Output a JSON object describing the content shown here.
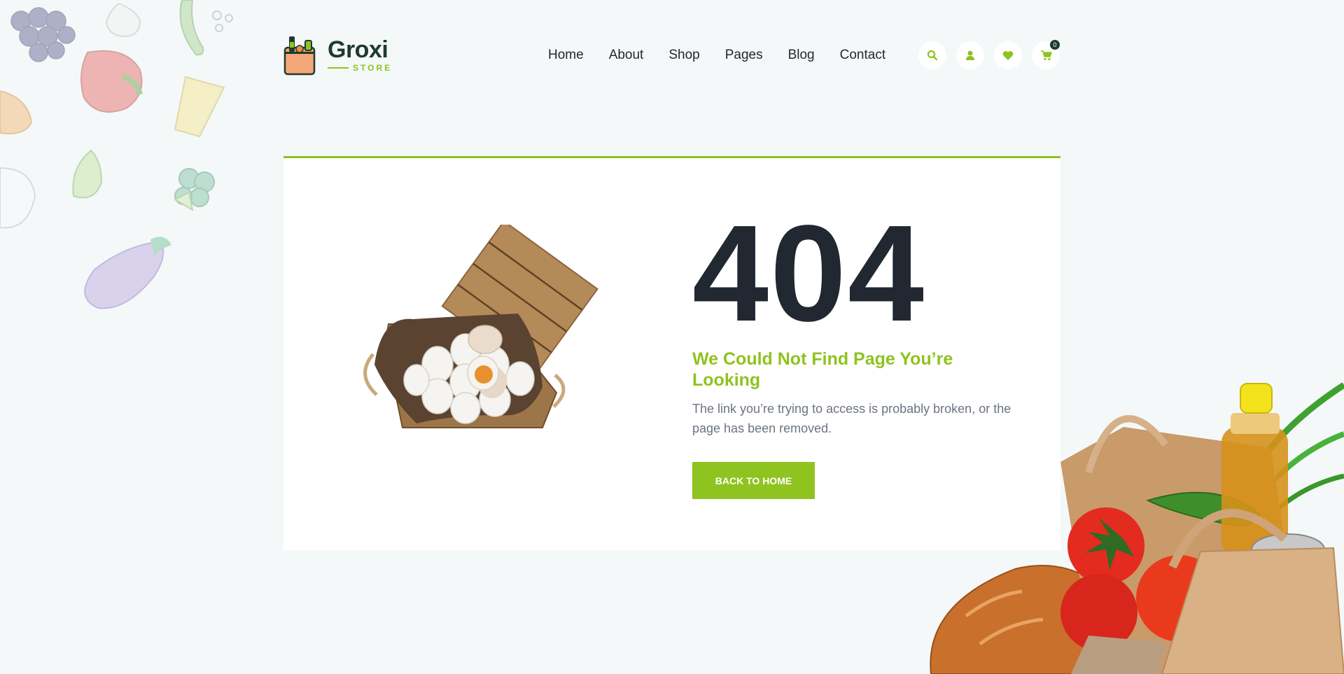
{
  "brand": {
    "name": "Groxi",
    "sub": "STORE"
  },
  "nav": {
    "items": [
      {
        "label": "Home"
      },
      {
        "label": "About"
      },
      {
        "label": "Shop"
      },
      {
        "label": "Pages"
      },
      {
        "label": "Blog"
      },
      {
        "label": "Contact"
      }
    ]
  },
  "actions": {
    "search_icon": "search-icon",
    "user_icon": "user-icon",
    "wishlist_icon": "heart-icon",
    "cart_icon": "cart-icon",
    "cart_count": "0"
  },
  "error": {
    "code": "404",
    "title": "We Could Not Find Page You’re Looking",
    "description": "The link you’re trying to access is probably broken, or the page has been removed.",
    "button_label": "BACK TO HOME"
  },
  "colors": {
    "accent": "#8fc31f",
    "dark": "#222831",
    "brand_dark": "#1f3b2d",
    "background": "#f4f8f9"
  }
}
